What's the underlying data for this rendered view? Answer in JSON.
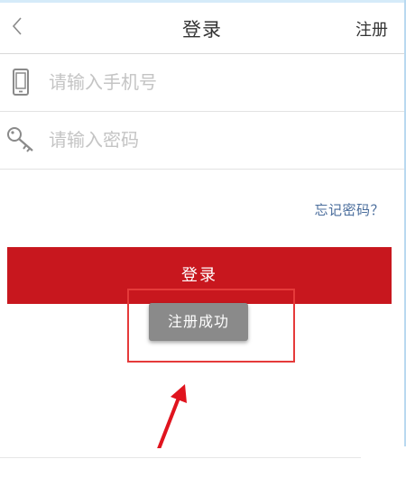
{
  "header": {
    "back_icon": "chevron-left-icon",
    "title": "登录",
    "register_label": "注册"
  },
  "form": {
    "phone_icon": "phone-icon",
    "phone_placeholder": "请输入手机号",
    "phone_value": "",
    "password_icon": "key-icon",
    "password_placeholder": "请输入密码",
    "password_value": ""
  },
  "forgot_label": "忘记密码？",
  "login_label": "登录",
  "toast": {
    "message": "注册成功"
  },
  "annotation": {
    "highlight_color": "#e53a3a",
    "arrow_icon": "arrow-up-icon"
  },
  "colors": {
    "primary_red": "#c8171e",
    "link_blue": "#4a6d9c",
    "toast_gray": "#8a8a8a"
  }
}
